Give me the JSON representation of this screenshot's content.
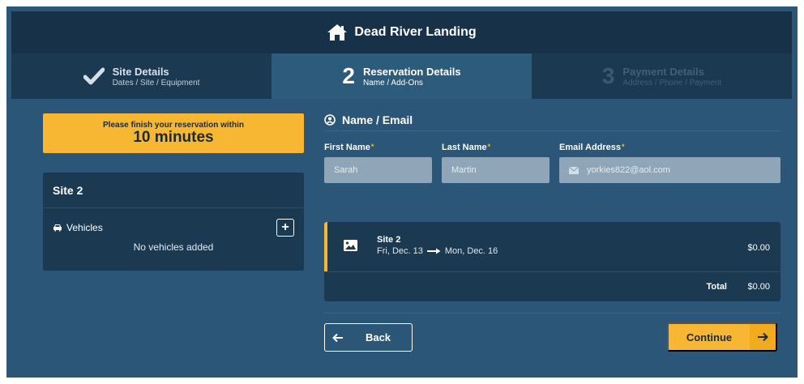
{
  "header": {
    "title": "Dead River Landing",
    "icon": "home-icon"
  },
  "steps": [
    {
      "title": "Site Details",
      "subtitle": "Dates / Site / Equipment",
      "state": "complete",
      "icon": "check-icon"
    },
    {
      "number": "2",
      "title": "Reservation Details",
      "subtitle": "Name / Add-Ons",
      "state": "active"
    },
    {
      "number": "3",
      "title": "Payment Details",
      "subtitle": "Address / Phone / Payment",
      "state": "disabled"
    }
  ],
  "timer": {
    "label": "Please finish your reservation within",
    "value": "10 minutes"
  },
  "site_card": {
    "title": "Site 2",
    "vehicles_label": "Vehicles",
    "add_symbol": "+",
    "empty_text": "No vehicles added"
  },
  "name_email": {
    "title": "Name / Email",
    "required_marker": "*",
    "first_name": {
      "label": "First Name",
      "value": "Sarah"
    },
    "last_name": {
      "label": "Last Name",
      "value": "Martin"
    },
    "email": {
      "label": "Email Address",
      "value": "yorkies822@aol.com"
    }
  },
  "summary": {
    "site": "Site 2",
    "date_from": "Fri, Dec. 13",
    "date_to": "Mon, Dec. 16",
    "price": "$0.00",
    "total_label": "Total",
    "total_value": "$0.00"
  },
  "buttons": {
    "back": "Back",
    "continue": "Continue"
  },
  "colors": {
    "accent": "#f7b733",
    "background": "#2b5677",
    "panel": "#1b3a52",
    "header": "#173248"
  }
}
